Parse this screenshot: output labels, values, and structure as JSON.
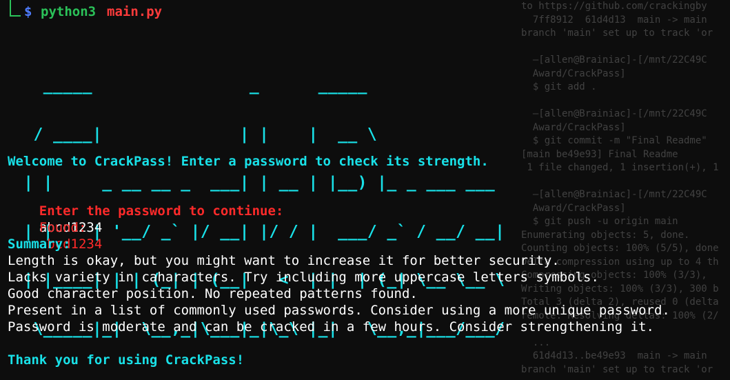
{
  "prompt": {
    "symbol": "$",
    "command": "python3",
    "argument": "main.py"
  },
  "banner": {
    "ascii_lines": [
      "   _____                _      _____              ",
      "  / ____|              | |    |  __ \\             ",
      " | |     _ __ __ _  ___| | __ | |__) |_ _ ___ ___ ",
      " | |    | '__/ _` |/ __| |/ / |  ___/ _` / __/ __|",
      " | |____| | | (_| | (__|   <  | |  | (_| \\__ \\__ \\",
      "  \\_____|_|  \\__,_|\\___|_|\\_\\ |_|   \\__,_|___/___/"
    ]
  },
  "welcome": "Welcome to CrackPass! Enter a password to check its strength.",
  "input": {
    "prompt_label": "Enter the password to continue:",
    "value": "abcd1234"
  },
  "found": {
    "label": "Found:",
    "value": "abcd1234"
  },
  "summary": {
    "heading": "Summary:",
    "lines": [
      "Length is okay, but you might want to increase it for better security.",
      "Lacks variety in caharacters. Try including more uppercase letters symbols.",
      "Good character position. No repeated patterns found.",
      "Present in a list of commonly used passwords. Consider using a more unique password.",
      "Password is moderate and can be cracked in a few hours. Consider strengthening it."
    ]
  },
  "farewell": "Thank you for using CrackPass!",
  "colors": {
    "cyan": "#19e1e8",
    "red": "#ff2a2a",
    "white": "#ffffff",
    "green": "#2bc259",
    "blue": "#4f7dff",
    "background": "#0d0d0d"
  }
}
